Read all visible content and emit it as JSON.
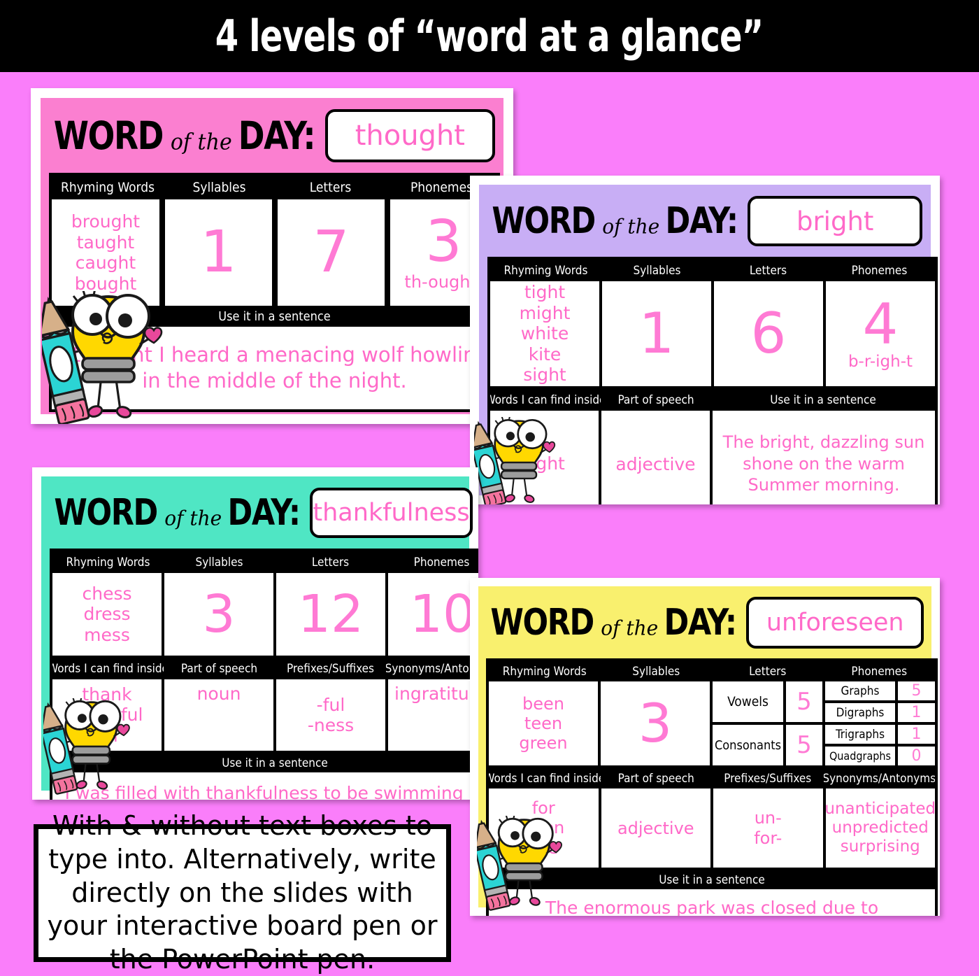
{
  "header": {
    "title": "4 levels of “word at a glance”"
  },
  "label": {
    "word": "WORD",
    "of_the": "of the",
    "day": "DAY:"
  },
  "columns": {
    "rhyming": "Rhyming Words",
    "syllables": "Syllables",
    "letters": "Letters",
    "phonemes": "Phonemes",
    "inside": "Words I can find inside",
    "part_of_speech": "Part of speech",
    "prefixes": "Prefixes/Suffixes",
    "synonyms": "Synonyms/Antonyms",
    "sentence": "Use it in a sentence",
    "vowels": "Vowels",
    "consonants": "Consonants",
    "graphs": "Graphs",
    "digraphs": "Digraphs",
    "trigraphs": "Trigraphs",
    "quadgraphs": "Quadgraphs"
  },
  "cards": [
    {
      "id": "card1",
      "accent": "#fb7fd0",
      "word": "thought",
      "rhyming": "brought\ntaught\ncaught\nbought",
      "syllables": "1",
      "letters": "7",
      "phonemes": "3",
      "phoneme_split": "th-ough-t",
      "sentence": "I thought I heard a menacing wolf howling in the middle of the night."
    },
    {
      "id": "card2",
      "accent": "#c8aef5",
      "word": "bright",
      "rhyming": "tight\nmight\nwhite\nkite\nsight",
      "syllables": "1",
      "letters": "6",
      "phonemes": "4",
      "phoneme_split": "b-r-igh-t",
      "inside": "right",
      "part_of_speech": "adjective",
      "sentence": "The bright, dazzling sun shone on the warm Summer morning."
    },
    {
      "id": "card3",
      "accent": "#4fe6c4",
      "word": "thankfulness",
      "rhyming": "chess\ndress\nmess",
      "syllables": "3",
      "letters": "12",
      "phonemes": "10",
      "inside": "thank\nthankful\nan",
      "part_of_speech": "noun",
      "prefixes": "-ful\n-ness",
      "synonyms": "ingratitude",
      "sentence": "I was filled with thankfulness to be swimming in the shimmering blue ocean."
    },
    {
      "id": "card4",
      "accent": "#f9f06e",
      "word": "unforeseen",
      "rhyming": "been\nteen\ngreen",
      "syllables": "3",
      "vowels_count": "5",
      "consonants_count": "5",
      "graphs_count": "5",
      "digraphs_count": "1",
      "trigraphs_count": "1",
      "quadgraphs_count": "0",
      "inside": "for\nSeen\nsee",
      "part_of_speech": "adjective",
      "prefixes": "un-\nfor-",
      "synonyms": "unanticipated\nunpredicted\nsurprising",
      "sentence": "The enormous park was closed due to unforeseen circumstances."
    }
  ],
  "note": {
    "text": "With & without text boxes to type into. Alternatively, write directly on the slides with your interactive board pen or the PowerPoint pen."
  },
  "colors": {
    "background": "#fa7efa",
    "text_pink": "#ff69c8",
    "black": "#000000",
    "white": "#ffffff"
  }
}
